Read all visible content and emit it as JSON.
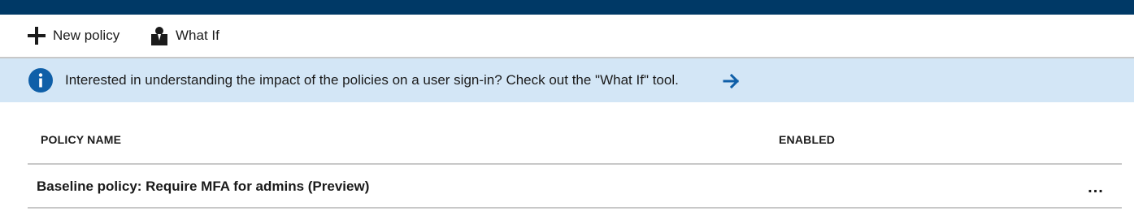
{
  "colors": {
    "header_bar": "#003966",
    "info_bar_bg": "#d3e6f6",
    "info_icon": "#0f5fa8",
    "divider": "#c8c8c8"
  },
  "toolbar": {
    "new_policy": {
      "label": "New policy",
      "icon": "plus-icon"
    },
    "what_if": {
      "label": "What If",
      "icon": "person-icon"
    }
  },
  "info_banner": {
    "icon": "info-icon",
    "text": "Interested in understanding the impact of the policies on a user sign-in? Check out the \"What If\" tool.",
    "link_icon": "arrow-right-icon"
  },
  "table": {
    "columns": {
      "policy_name": "POLICY NAME",
      "enabled": "ENABLED"
    },
    "rows": [
      {
        "policy_name": "Baseline policy: Require MFA for admins (Preview)",
        "enabled": "",
        "more": "..."
      }
    ]
  }
}
